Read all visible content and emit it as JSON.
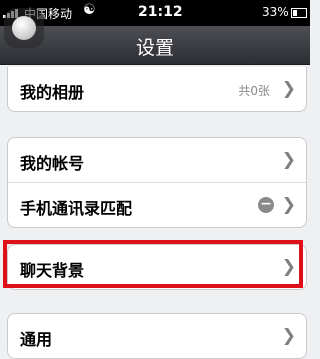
{
  "status_bar": {
    "carrier": "中国移动",
    "time": "21:12",
    "battery_percent": "33%",
    "battery_level": 0.33,
    "wifi_icon": "wifi-icon"
  },
  "nav": {
    "title": "设置"
  },
  "groups": [
    {
      "rows": [
        {
          "label": "我的相册",
          "value": "共0张"
        }
      ]
    },
    {
      "rows": [
        {
          "label": "我的帐号"
        },
        {
          "label": "手机通讯录匹配",
          "badge": "−"
        }
      ]
    },
    {
      "rows": [
        {
          "label": "聊天背景",
          "highlighted": true
        }
      ]
    },
    {
      "rows": [
        {
          "label": "通用"
        }
      ]
    }
  ],
  "colors": {
    "highlight": "#e0101a",
    "navbar": "#3a3c41"
  }
}
